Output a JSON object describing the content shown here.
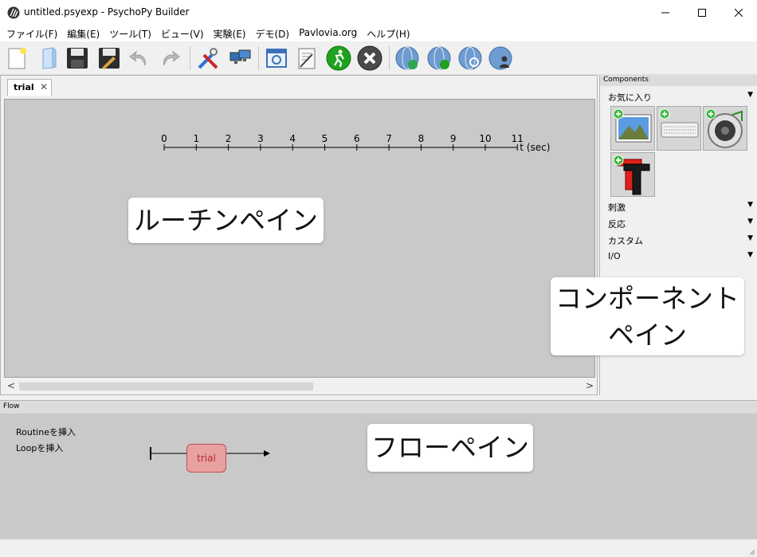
{
  "window": {
    "title": "untitled.psyexp - PsychoPy Builder",
    "controls": [
      "minimize-icon",
      "maximize-icon",
      "close-icon"
    ]
  },
  "menu": [
    "ファイル(F)",
    "編集(E)",
    "ツール(T)",
    "ビュー(V)",
    "実験(E)",
    "デモ(D)",
    "Pavlovia.org",
    "ヘルプ(H)"
  ],
  "toolbar": {
    "icons": [
      "new-file-icon",
      "open-file-icon",
      "save-icon",
      "save-as-icon",
      "undo-icon",
      "redo-icon",
      "preferences-icon",
      "monitor-center-icon",
      "experiment-settings-icon",
      "compile-script-icon",
      "run-icon",
      "stop-icon",
      "pavlovia-sync-icon",
      "pavlovia-run-icon",
      "pavlovia-search-icon",
      "pavlovia-user-icon"
    ]
  },
  "routine": {
    "tab_label": "trial",
    "tab_close": "✕",
    "timeline_ticks": [
      "0",
      "1",
      "2",
      "3",
      "4",
      "5",
      "6",
      "7",
      "8",
      "9",
      "10",
      "11"
    ],
    "timeline_unit": "t (sec)",
    "scroll_left": "<",
    "scroll_right": ">"
  },
  "components": {
    "title": "Components",
    "favorites_label": "お気に入り",
    "favorites_icons": [
      "image-component-icon",
      "keyboard-component-icon",
      "sound-component-icon",
      "text-component-icon"
    ],
    "categories": [
      "刺激",
      "反応",
      "カスタム",
      "I/O"
    ],
    "dropdown_arrow": "▼"
  },
  "flow": {
    "title": "Flow",
    "insert_routine": "Routineを挿入",
    "insert_loop": "Loopを挿入",
    "routine_box": "trial"
  },
  "callouts": {
    "routine_pane": "ルーチンペイン",
    "component_pane_line1": "コンポーネント",
    "component_pane_line2": "ペイン",
    "flow_pane": "フローペイン"
  },
  "colors": {
    "canvas": "#c9c9c9",
    "flow_routine_fill": "#e8a0a0",
    "flow_routine_text": "#b03030",
    "run_green": "#1fa21f",
    "stop_gray": "#4a4a4a"
  }
}
